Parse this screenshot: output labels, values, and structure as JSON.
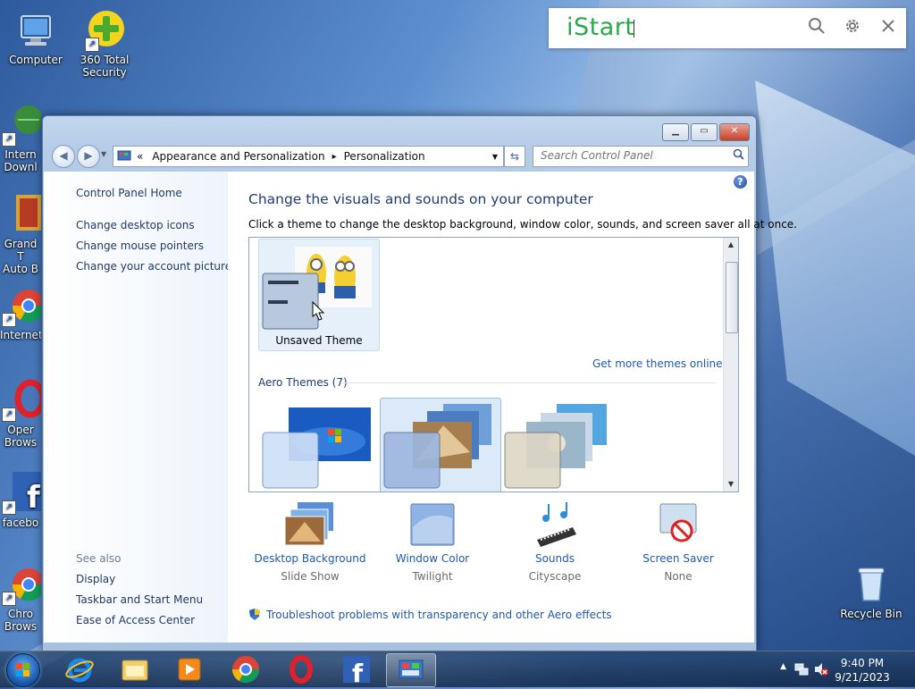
{
  "desktop": {
    "icons": [
      {
        "label": "Computer"
      },
      {
        "label": "360 Total\nSecurity"
      },
      {
        "label": "Intern\nDownl"
      },
      {
        "label": "Grand T\nAuto B"
      },
      {
        "label": "Internet"
      },
      {
        "label": "Oper\nBrows"
      },
      {
        "label": "facebo"
      },
      {
        "label": "Chro\nBrows"
      },
      {
        "label": "Recycle Bin"
      }
    ]
  },
  "istart": {
    "logo": "iStart",
    "search_icon": "search-icon",
    "settings_icon": "gear-icon",
    "close_icon": "close-icon"
  },
  "window": {
    "breadcrumb": {
      "root": "«",
      "item1": "Appearance and Personalization",
      "sep": "▸",
      "item2": "Personalization"
    },
    "search_placeholder": "Search Control Panel",
    "left_links": {
      "home": "Control Panel Home",
      "desktop_icons": "Change desktop icons",
      "mouse_pointers": "Change mouse pointers",
      "account_picture": "Change your account picture"
    },
    "see_also": {
      "title": "See also",
      "display": "Display",
      "taskbar": "Taskbar and Start Menu",
      "ease": "Ease of Access Center"
    },
    "main": {
      "title": "Change the visuals and sounds on your computer",
      "subtitle": "Click a theme to change the desktop background, window color, sounds, and screen saver all at once.",
      "unsaved_theme": "Unsaved Theme",
      "more_themes": "Get more themes online",
      "aero_themes": "Aero Themes (7)"
    },
    "options": [
      {
        "name": "Desktop Background",
        "value": "Slide Show"
      },
      {
        "name": "Window Color",
        "value": "Twilight"
      },
      {
        "name": "Sounds",
        "value": "Cityscape"
      },
      {
        "name": "Screen Saver",
        "value": "None"
      }
    ],
    "troubleshoot": "Troubleshoot problems with transparency and other Aero effects"
  },
  "taskbar": {
    "time": "9:40 PM",
    "date": "9/21/2023"
  },
  "colors": {
    "link": "#1f58ad",
    "title": "#1e3b7a",
    "istart_green": "#2aa84a"
  }
}
